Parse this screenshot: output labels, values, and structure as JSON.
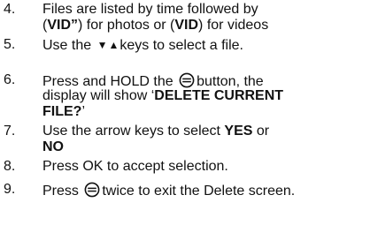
{
  "steps": [
    {
      "number": "4.",
      "line1": "Files are listed by time followed by",
      "line2_open": "(",
      "line2_bold1": "VID”",
      "line2_mid": ") for photos or (",
      "line2_bold2": "VID",
      "line2_end": ") for videos"
    },
    {
      "number": "5.",
      "before": "Use the",
      "arrows": "▼▲",
      "after": "keys to select a file."
    },
    {
      "number": "6.",
      "before": "Press and HOLD the",
      "after": "button, the",
      "line2": "display will show ‘",
      "line2_bold": "DELETE CURRENT",
      "line3_bold": "FILE?",
      "line3_end": "’",
      "icon": "menu-icon"
    },
    {
      "number": "7.",
      "line1": "Use the arrow keys to select ",
      "line1_bold": "YES",
      "line1_end": " or",
      "line2_bold": "NO"
    },
    {
      "number": "8.",
      "text": "Press OK to accept selection."
    },
    {
      "number": "9.",
      "before": "Press",
      "after": "twice to exit the Delete screen.",
      "icon": "menu-icon"
    }
  ]
}
